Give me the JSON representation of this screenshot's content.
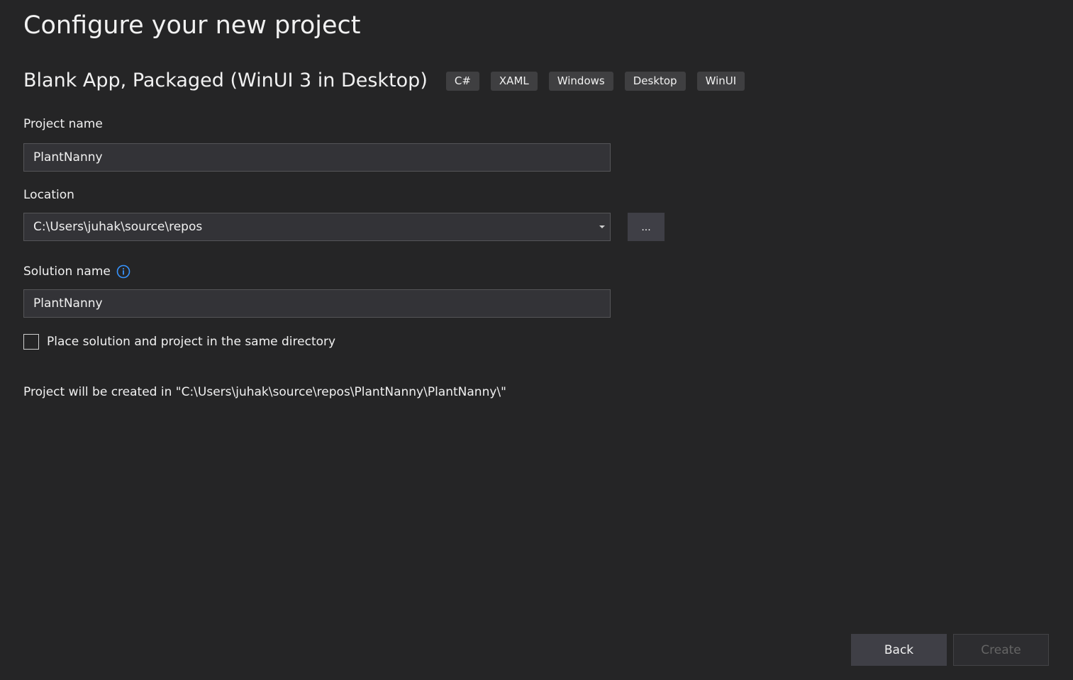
{
  "header": {
    "title": "Configure your new project"
  },
  "template": {
    "name": "Blank App, Packaged (WinUI 3 in Desktop)",
    "tags": [
      "C#",
      "XAML",
      "Windows",
      "Desktop",
      "WinUI"
    ]
  },
  "form": {
    "project_name": {
      "label": "Project name",
      "value": "PlantNanny"
    },
    "location": {
      "label": "Location",
      "value": "C:\\Users\\juhak\\source\\repos",
      "browse_label": "..."
    },
    "solution_name": {
      "label": "Solution name",
      "value": "PlantNanny",
      "info_icon": "info-icon"
    },
    "same_directory": {
      "label": "Place solution and project in the same directory",
      "checked": false
    }
  },
  "summary": {
    "path_text": "Project will be created in \"C:\\Users\\juhak\\source\\repos\\PlantNanny\\PlantNanny\\\""
  },
  "footer": {
    "back_label": "Back",
    "create_label": "Create",
    "create_enabled": false
  },
  "colors": {
    "background": "#252526",
    "info_accent": "#3794ff",
    "disabled_text": "#656565"
  }
}
